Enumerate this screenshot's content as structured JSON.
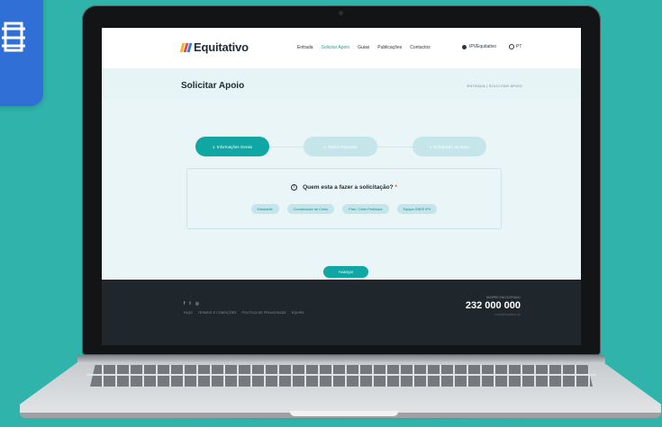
{
  "site": {
    "logo_text": "Equitativo",
    "logo_colors": [
      "#f2b632",
      "#e24d56",
      "#3c7bd8"
    ],
    "nav": [
      "Entrada",
      "Solicitar Apoio",
      "Guias",
      "Publicações",
      "Contactos"
    ],
    "nav_active_index": 1,
    "user_label": "IPVEquitativo",
    "lang_label": "PT"
  },
  "page": {
    "title": "Solicitar Apoio",
    "breadcrumb": "ENTRADA  |  SOLICITAR APOIO"
  },
  "wizard": {
    "steps": [
      "1. Informações Gerais",
      "2. Dados Pessoais",
      "3. Solicitação de Apoio"
    ],
    "active_step": 1,
    "question": "Quem esta a fazer a solicitação?",
    "required_mark": "*",
    "info_icon_glyph": "!",
    "options": [
      "Estudante",
      "Coordenador de Curso",
      "Pais / Outro Professor",
      "Equipa GNEE IPV"
    ],
    "next_label": "Avançar"
  },
  "footer": {
    "social": [
      "f",
      "t",
      "◎"
    ],
    "links": [
      "FAQS",
      "TERMOS E CONDIÇÕES",
      "POLÍTICA DE PRIVACIDADE",
      "EQUIPA"
    ],
    "phone_label": "SEMPRE ENCONTRADO",
    "phone": "232 000 000",
    "email": "email@equitativo.pt"
  },
  "colors": {
    "background": "#2fb3aa",
    "accent": "#0fa6a3",
    "footer": "#1f262c",
    "badge": "#2f6fd6"
  },
  "icons": {
    "corner_badge": "building-icon",
    "user": "user-icon",
    "lang": "globe-icon"
  }
}
